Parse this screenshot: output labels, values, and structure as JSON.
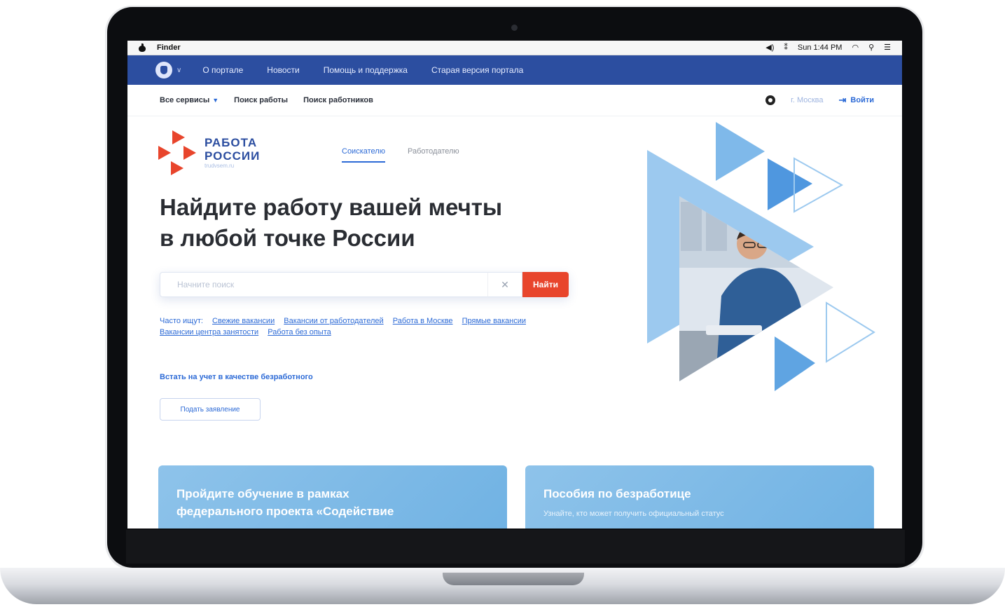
{
  "menubar": {
    "app": "Finder",
    "status": [
      "◀)",
      "⁑",
      "Sun 1:44 PM"
    ]
  },
  "gov_bar": {
    "links": [
      "О портале",
      "Новости",
      "Помощь и поддержка",
      "Старая версия портала"
    ]
  },
  "services_bar": {
    "all_services": "Все сервисы",
    "links": [
      "Поиск работы",
      "Поиск работников"
    ],
    "city": "г. Москва",
    "login": "Войти"
  },
  "logo": {
    "line1": "РАБОТА",
    "line2": "РОССИИ",
    "sub": "trudvsem.ru"
  },
  "tabs": [
    "Соискателю",
    "Работодателю"
  ],
  "headline": {
    "line1": "Найдите работу вашей мечты",
    "line2": "в любой точке России"
  },
  "search": {
    "placeholder": "Начните поиск",
    "button": "Найти"
  },
  "often": {
    "label": "Часто ищут:",
    "links": [
      "Свежие вакансии",
      "Вакансии от работодателей",
      "Работа в Москве",
      "Прямые вакансии",
      "Вакансии центра занятости",
      "Работа без опыта"
    ]
  },
  "register_link": "Встать на учет в качестве безработного",
  "apply_button": "Подать заявление",
  "cards": [
    {
      "title_line1": "Пройдите обучение в рамках",
      "title_line2": "федерального проекта «Содействие",
      "text": ""
    },
    {
      "title_line1": "Пособия по безработице",
      "title_line2": "",
      "text": "Узнайте, кто может получить официальный статус"
    }
  ],
  "colors": {
    "gov_blue": "#2c4ea0",
    "accent_blue": "#2c6ad6",
    "accent_red": "#e8452c",
    "card_blue": "#7ab7e6"
  }
}
